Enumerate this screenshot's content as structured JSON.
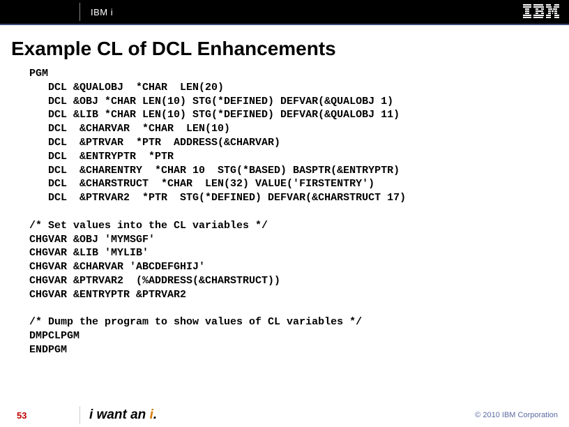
{
  "header": {
    "section_label": "IBM i"
  },
  "title": "Example CL of DCL Enhancements",
  "code": "PGM\n   DCL &QUALOBJ  *CHAR  LEN(20)\n   DCL &OBJ *CHAR LEN(10) STG(*DEFINED) DEFVAR(&QUALOBJ 1)\n   DCL &LIB *CHAR LEN(10) STG(*DEFINED) DEFVAR(&QUALOBJ 11)\n   DCL  &CHARVAR  *CHAR  LEN(10)\n   DCL  &PTRVAR  *PTR  ADDRESS(&CHARVAR)\n   DCL  &ENTRYPTR  *PTR\n   DCL  &CHARENTRY  *CHAR 10  STG(*BASED) BASPTR(&ENTRYPTR)\n   DCL  &CHARSTRUCT  *CHAR  LEN(32) VALUE('FIRSTENTRY')\n   DCL  &PTRVAR2  *PTR  STG(*DEFINED) DEFVAR(&CHARSTRUCT 17)\n\n/* Set values into the CL variables */\nCHGVAR &OBJ 'MYMSGF'\nCHGVAR &LIB 'MYLIB'\nCHGVAR &CHARVAR 'ABCDEFGHIJ'\nCHGVAR &PTRVAR2  (%ADDRESS(&CHARSTRUCT))\nCHGVAR &ENTRYPTR &PTRVAR2\n\n/* Dump the program to show values of CL variables */\nDMPCLPGM\nENDPGM",
  "footer": {
    "page_number": "53",
    "tagline_prefix": "i want an ",
    "tagline_accent": "i",
    "tagline_suffix": ".",
    "copyright": "© 2010 IBM Corporation"
  }
}
